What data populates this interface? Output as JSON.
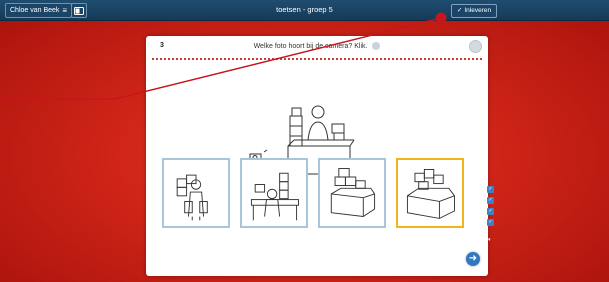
{
  "topbar": {
    "user_name": "Chloe van Beek",
    "menu_glyph": "≡",
    "title": "toetsen - groep 5",
    "submit_label": "Inleveren",
    "submit_check": "✓"
  },
  "question": {
    "number": "3",
    "text": "Welke foto hoort bij de camera? Klik."
  },
  "options": [
    {
      "name": "option-1"
    },
    {
      "name": "option-2"
    },
    {
      "name": "option-3"
    },
    {
      "name": "option-4",
      "selected": true
    }
  ],
  "side_checks": [
    "✓",
    "✓",
    "✓",
    "✓"
  ],
  "side_down": "▾",
  "next_arrow": "➜",
  "colors": {
    "topbar": "#1a4262",
    "background": "#cf2418",
    "accent_blue": "#2f79c4",
    "callout_red": "#c8151b",
    "option_border": "#a7c7d9",
    "option_selected": "#f1b51c"
  }
}
